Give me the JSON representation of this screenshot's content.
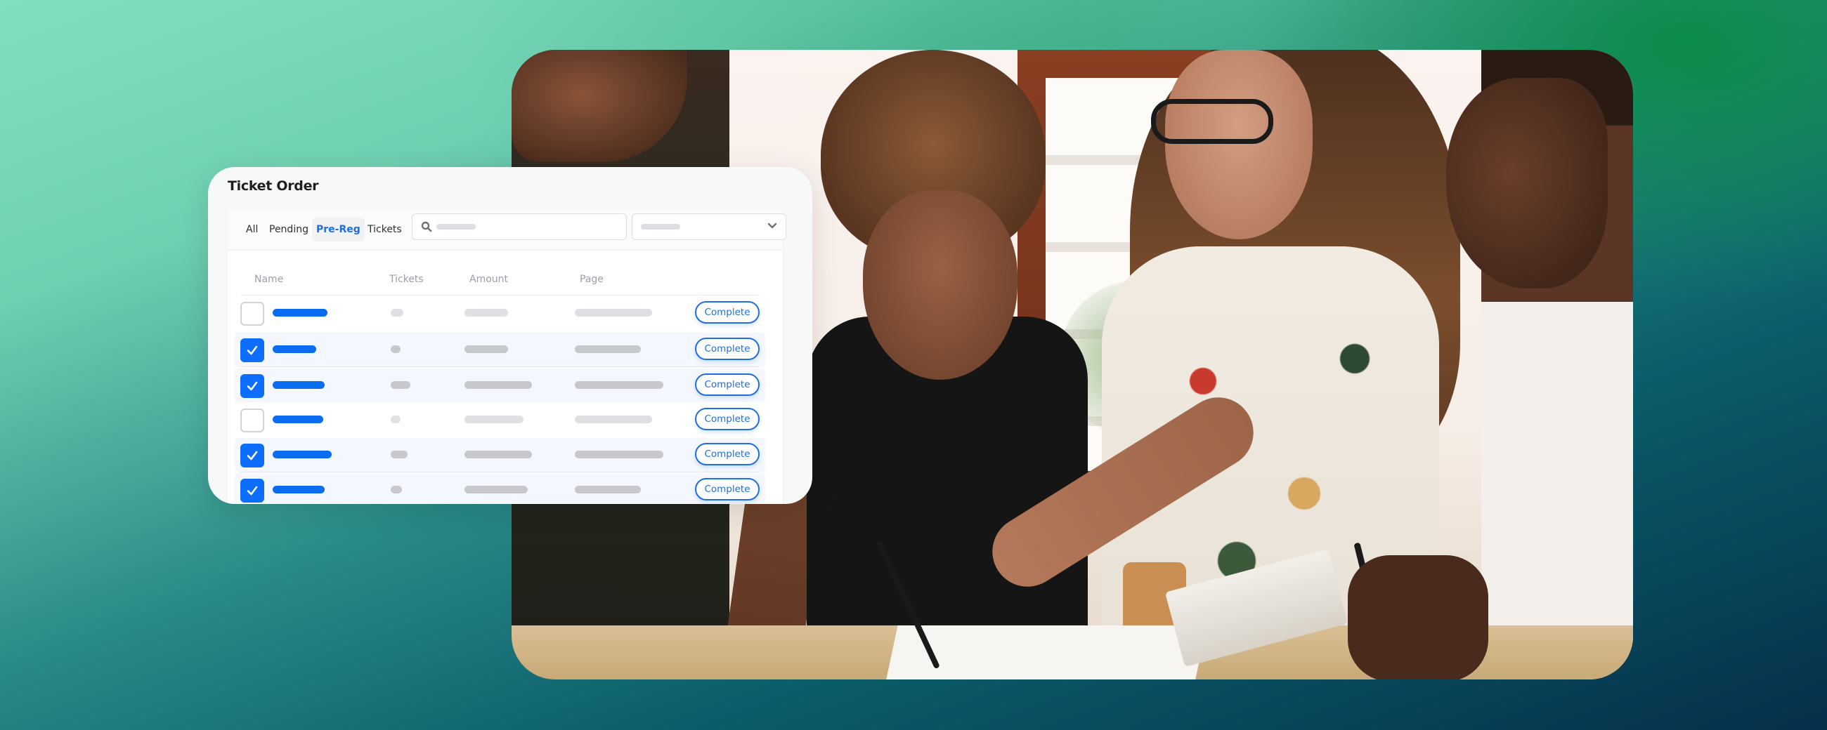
{
  "card": {
    "title": "Ticket Order",
    "tabs": [
      {
        "label": "All",
        "active": false
      },
      {
        "label": "Pending",
        "active": false
      },
      {
        "label": "Pre-Reg",
        "active": true
      },
      {
        "label": "Tickets",
        "active": false
      }
    ],
    "search": {
      "icon": "search-icon",
      "placeholder": ""
    },
    "filter_select": {
      "icon": "chevron-down-icon",
      "value": ""
    },
    "columns": [
      "Name",
      "Tickets",
      "Amount",
      "Page"
    ],
    "rows": [
      {
        "checked": false,
        "action": "Complete"
      },
      {
        "checked": true,
        "action": "Complete"
      },
      {
        "checked": true,
        "action": "Complete"
      },
      {
        "checked": false,
        "action": "Complete"
      },
      {
        "checked": true,
        "action": "Complete"
      },
      {
        "checked": true,
        "action": "Complete"
      }
    ]
  },
  "colors": {
    "accent": "#0d6efd",
    "link_blue": "#1f6fe0",
    "background_top_left": "#80e0bd",
    "background_top_right": "#0a8a45",
    "background_bottom": "#062f4a"
  },
  "photo": {
    "description": "Four people gathered around a table writing and reviewing papers"
  }
}
